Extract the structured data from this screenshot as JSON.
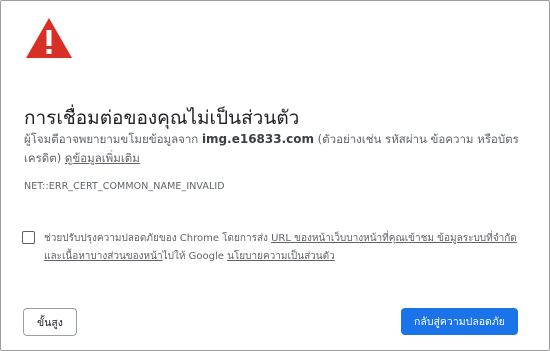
{
  "page": {
    "title": "การเชื่อมต่อของคุณไม่เป็นส่วนตัว",
    "icon": "warning-triangle-icon",
    "accent_color": "#d93025"
  },
  "description": {
    "prefix": "ผู้โจมตีอาจพยายามขโมยข้อมูลจาก ",
    "host": "img.e16833.com",
    "suffix": " (ตัวอย่างเช่น รหัสผ่าน ข้อความ หรือบัตรเครดิต) ",
    "learn_more": "ดูข้อมูลเพิ่มเติม"
  },
  "error_code": "NET::ERR_CERT_COMMON_NAME_INVALID",
  "checkbox": {
    "checked": false,
    "text_1": "ช่วยปรับปรุงความปลอดภัยของ Chrome โดยการส่ง ",
    "link_1": "URL ของหน้าเว็บบางหน้าที่คุณเข้าชม ข้อมูลระบบที่จำกัด และเนื้อหาบางส่วนของหน้า",
    "text_2": "ไปให้ Google ",
    "link_2": "นโยบายความเป็นส่วนตัว"
  },
  "buttons": {
    "advanced": "ขั้นสูง",
    "back_to_safety": "กลับสู่ความปลอดภัย",
    "primary_color": "#1a73e8"
  }
}
